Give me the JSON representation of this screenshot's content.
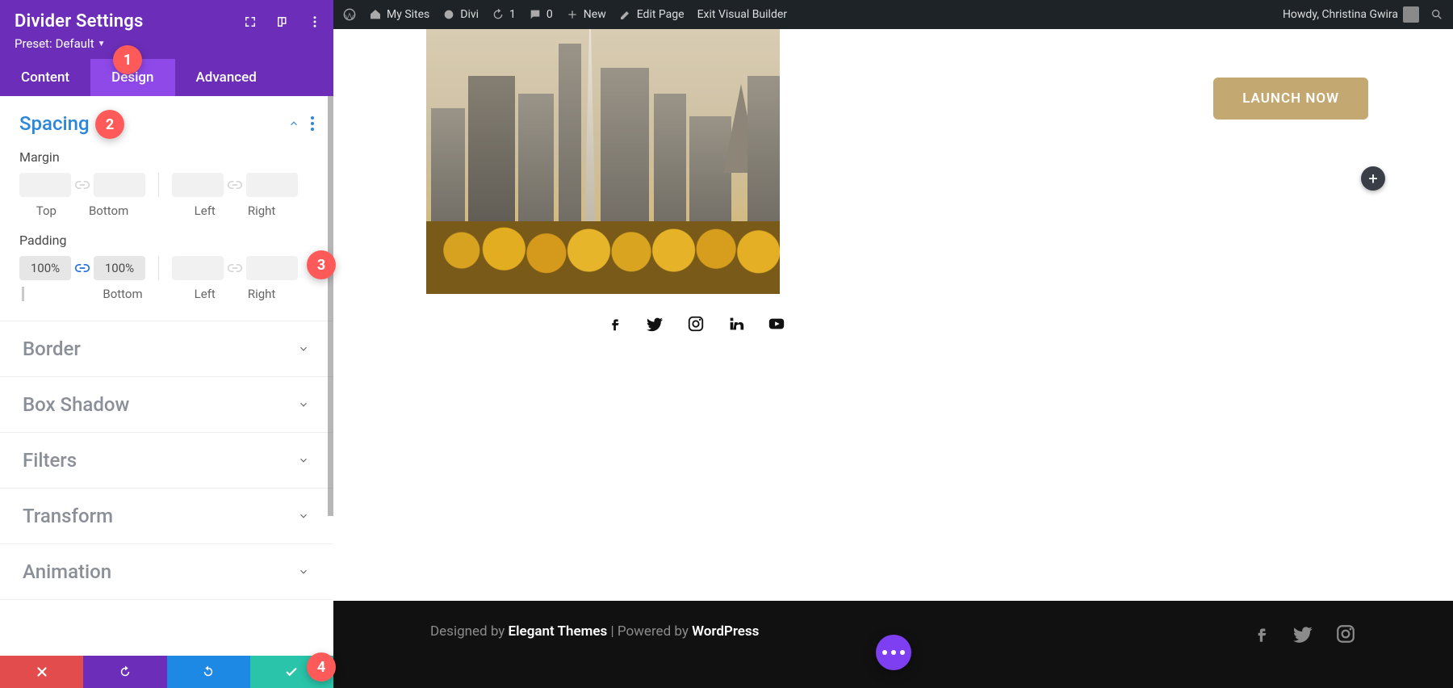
{
  "panel": {
    "title": "Divider Settings",
    "preset_label": "Preset:",
    "preset_value": "Default",
    "tabs": {
      "content": "Content",
      "design": "Design",
      "advanced": "Advanced"
    },
    "sections": {
      "spacing": "Spacing",
      "margin": "Margin",
      "padding": "Padding",
      "axes": {
        "top": "Top",
        "bottom": "Bottom",
        "left": "Left",
        "right": "Right"
      },
      "padding_top": "100%",
      "padding_bottom": "100%",
      "border": "Border",
      "box_shadow": "Box Shadow",
      "filters": "Filters",
      "transform": "Transform",
      "animation": "Animation"
    }
  },
  "callouts": {
    "c1": "1",
    "c2": "2",
    "c3": "3",
    "c4": "4"
  },
  "adminbar": {
    "my_sites": "My Sites",
    "site_name": "Divi",
    "updates": "1",
    "comments": "0",
    "new": "New",
    "edit": "Edit Page",
    "exit": "Exit Visual Builder",
    "howdy": "Howdy, Christina Gwira"
  },
  "page": {
    "launch": "LAUNCH NOW",
    "footer_designed": "Designed by ",
    "footer_theme": "Elegant Themes",
    "footer_sep": " | Powered by ",
    "footer_wp": "WordPress"
  },
  "colors": {
    "close": "#e24c4c",
    "undo": "#6c2eb9",
    "redo": "#1e88e5",
    "save": "#29c4a9"
  }
}
